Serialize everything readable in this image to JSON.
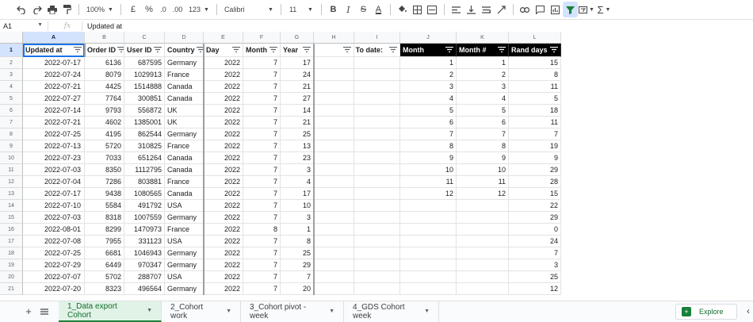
{
  "toolbar": {
    "zoom": "100%",
    "currency": "£",
    "percent": "%",
    "dec_less": ".0",
    "dec_more": ".00",
    "format_123": "123",
    "font": "Calibri",
    "font_size": "11",
    "bold": "B",
    "italic": "I",
    "strike": "S",
    "text_color": "A"
  },
  "formula_bar": {
    "cell_ref": "A1",
    "fx": "fx",
    "content": "Updated at"
  },
  "columns": [
    "A",
    "B",
    "C",
    "D",
    "E",
    "F",
    "G",
    "H",
    "I",
    "J",
    "K",
    "L"
  ],
  "header_row": [
    "Updated at",
    "Order ID",
    "User ID",
    "Country",
    "Day",
    "Month",
    "Year",
    "",
    "To date:",
    "Month",
    "Month #",
    "Rand days"
  ],
  "rows": [
    [
      "2022-07-17",
      "6136",
      "687595",
      "Germany",
      "2022",
      "7",
      "17",
      "",
      "",
      "1",
      "1",
      "15"
    ],
    [
      "2022-07-24",
      "8079",
      "1029913",
      "France",
      "2022",
      "7",
      "24",
      "",
      "",
      "2",
      "2",
      "8"
    ],
    [
      "2022-07-21",
      "4425",
      "1514888",
      "Canada",
      "2022",
      "7",
      "21",
      "",
      "",
      "3",
      "3",
      "11"
    ],
    [
      "2022-07-27",
      "7764",
      "300851",
      "Canada",
      "2022",
      "7",
      "27",
      "",
      "",
      "4",
      "4",
      "5"
    ],
    [
      "2022-07-14",
      "9793",
      "556872",
      "UK",
      "2022",
      "7",
      "14",
      "",
      "",
      "5",
      "5",
      "18"
    ],
    [
      "2022-07-21",
      "4602",
      "1385001",
      "UK",
      "2022",
      "7",
      "21",
      "",
      "",
      "6",
      "6",
      "11"
    ],
    [
      "2022-07-25",
      "4195",
      "862544",
      "Germany",
      "2022",
      "7",
      "25",
      "",
      "",
      "7",
      "7",
      "7"
    ],
    [
      "2022-07-13",
      "5720",
      "310825",
      "France",
      "2022",
      "7",
      "13",
      "",
      "",
      "8",
      "8",
      "19"
    ],
    [
      "2022-07-23",
      "7033",
      "651264",
      "Canada",
      "2022",
      "7",
      "23",
      "",
      "",
      "9",
      "9",
      "9"
    ],
    [
      "2022-07-03",
      "8350",
      "1112795",
      "Canada",
      "2022",
      "7",
      "3",
      "",
      "",
      "10",
      "10",
      "29"
    ],
    [
      "2022-07-04",
      "7286",
      "803881",
      "France",
      "2022",
      "7",
      "4",
      "",
      "",
      "11",
      "11",
      "28"
    ],
    [
      "2022-07-17",
      "9438",
      "1080565",
      "Canada",
      "2022",
      "7",
      "17",
      "",
      "",
      "12",
      "12",
      "15"
    ],
    [
      "2022-07-10",
      "5584",
      "491792",
      "USA",
      "2022",
      "7",
      "10",
      "",
      "",
      "",
      "",
      "22"
    ],
    [
      "2022-07-03",
      "8318",
      "1007559",
      "Germany",
      "2022",
      "7",
      "3",
      "",
      "",
      "",
      "",
      "29"
    ],
    [
      "2022-08-01",
      "8299",
      "1470973",
      "France",
      "2022",
      "8",
      "1",
      "",
      "",
      "",
      "",
      "0"
    ],
    [
      "2022-07-08",
      "7955",
      "331123",
      "USA",
      "2022",
      "7",
      "8",
      "",
      "",
      "",
      "",
      "24"
    ],
    [
      "2022-07-25",
      "6681",
      "1046943",
      "Germany",
      "2022",
      "7",
      "25",
      "",
      "",
      "",
      "",
      "7"
    ],
    [
      "2022-07-29",
      "6449",
      "970347",
      "Germany",
      "2022",
      "7",
      "29",
      "",
      "",
      "",
      "",
      "3"
    ],
    [
      "2022-07-07",
      "5702",
      "288707",
      "USA",
      "2022",
      "7",
      "7",
      "",
      "",
      "",
      "",
      "25"
    ],
    [
      "2022-07-20",
      "8323",
      "496564",
      "Germany",
      "2022",
      "7",
      "20",
      "",
      "",
      "",
      "",
      "12"
    ]
  ],
  "tabs": [
    {
      "label": "1_Data export Cohort",
      "active": true
    },
    {
      "label": "2_Cohort work",
      "active": false
    },
    {
      "label": "3_Cohort pivot - week",
      "active": false
    },
    {
      "label": "4_GDS Cohort week",
      "active": false
    }
  ],
  "explore_label": "Explore",
  "colors": {
    "accent": "#188038",
    "selection": "#1a73e8",
    "header_dark": "#000000"
  }
}
